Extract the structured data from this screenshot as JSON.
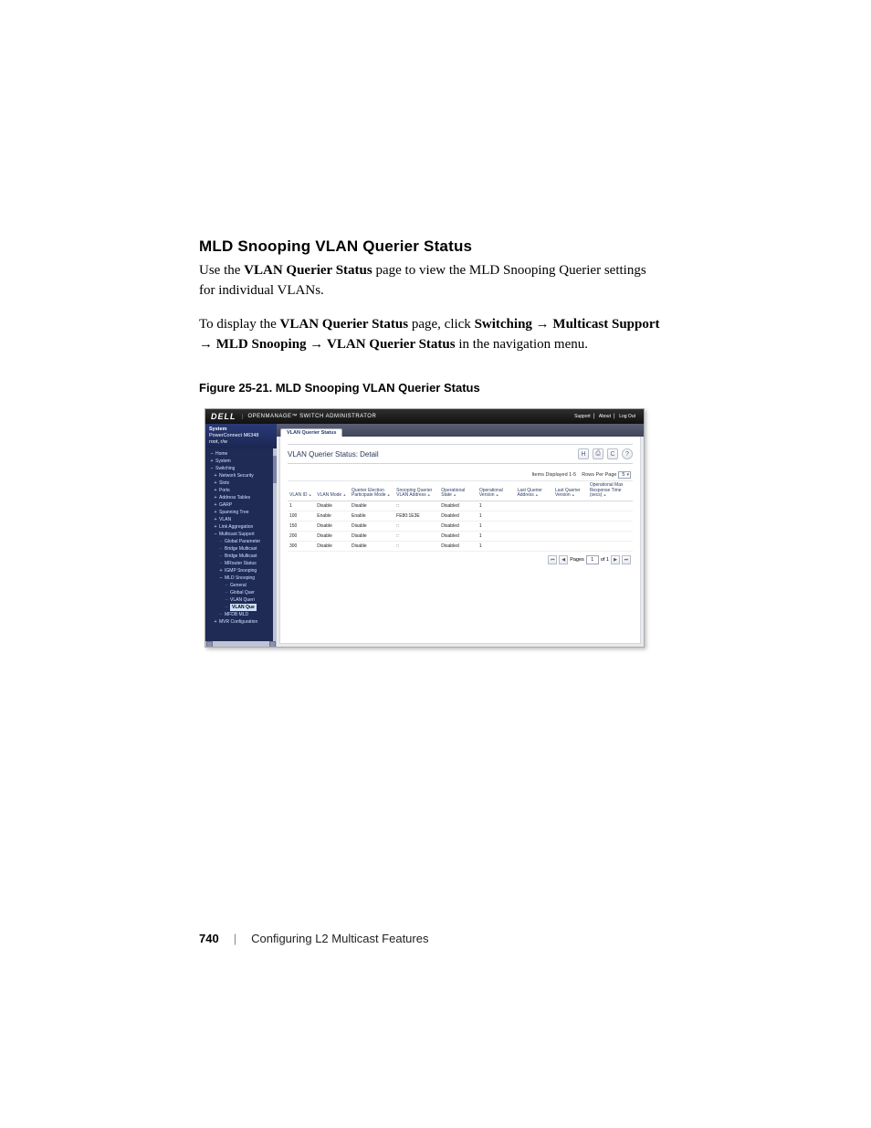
{
  "doc": {
    "section_title": "MLD Snooping VLAN Querier Status",
    "p1_a": "Use the ",
    "p1_b": "VLAN Querier Status",
    "p1_c": " page to view the MLD Snooping Querier settings for individual VLANs.",
    "p2_a": "To display the ",
    "p2_b": "VLAN Querier Status",
    "p2_c": " page, click ",
    "p2_d": "Switching",
    "p2_e": "Multicast Support",
    "p2_f": "MLD Snooping",
    "p2_g": "VLAN Querier Status",
    "p2_h": " in the navigation menu.",
    "arrow": "→",
    "fig_caption": "Figure 25-21.    MLD Snooping VLAN Querier Status",
    "footer_page": "740",
    "footer_section": "Configuring L2 Multicast Features"
  },
  "shot": {
    "brand_logo": "DELL",
    "brand_sub": "OPENMANAGE™ SWITCH ADMINISTRATOR",
    "top_links": {
      "support": "Support",
      "about": "About",
      "logout": "Log Out"
    },
    "sidebar": {
      "system": "System",
      "model": "PowerConnect M6348",
      "addr": "root, r/w",
      "tree": [
        {
          "g": "minus",
          "indent": 0,
          "label": "Home"
        },
        {
          "g": "plus",
          "indent": 0,
          "label": "System"
        },
        {
          "g": "minus",
          "indent": 0,
          "label": "Switching"
        },
        {
          "g": "plus",
          "indent": 1,
          "label": "Network Security"
        },
        {
          "g": "plus",
          "indent": 1,
          "label": "Slots"
        },
        {
          "g": "plus",
          "indent": 1,
          "label": "Ports"
        },
        {
          "g": "plus",
          "indent": 1,
          "label": "Address Tables"
        },
        {
          "g": "plus",
          "indent": 1,
          "label": "GARP"
        },
        {
          "g": "plus",
          "indent": 1,
          "label": "Spanning Tree"
        },
        {
          "g": "plus",
          "indent": 1,
          "label": "VLAN"
        },
        {
          "g": "plus",
          "indent": 1,
          "label": "Link Aggregation"
        },
        {
          "g": "minus",
          "indent": 1,
          "label": "Multicast Support"
        },
        {
          "g": "dash",
          "indent": 2,
          "label": "Global Parameter"
        },
        {
          "g": "dash",
          "indent": 2,
          "label": "Bridge Multicast"
        },
        {
          "g": "dash",
          "indent": 2,
          "label": "Bridge Multicast"
        },
        {
          "g": "dash",
          "indent": 2,
          "label": "MRouter Status"
        },
        {
          "g": "plus",
          "indent": 2,
          "label": "IGMP Snooping"
        },
        {
          "g": "minus",
          "indent": 2,
          "label": "MLD Snooping"
        },
        {
          "g": "dash",
          "indent": 3,
          "label": "General"
        },
        {
          "g": "dash",
          "indent": 3,
          "label": "Global Quer"
        },
        {
          "g": "dash",
          "indent": 3,
          "label": "VLAN Queri"
        },
        {
          "g": "dash",
          "indent": 3,
          "label": "VLAN Que",
          "highlight": true
        },
        {
          "g": "dash",
          "indent": 2,
          "label": "MFDB MLD"
        },
        {
          "g": "plus",
          "indent": 1,
          "label": "MVR Configuration"
        }
      ]
    },
    "tab": "VLAN Querier Status",
    "panel_title": "VLAN Querier Status: Detail",
    "tools": {
      "save": "H",
      "print": "⎙",
      "refresh": "C",
      "help": "?"
    },
    "items_displayed_label": "Items Displayed",
    "items_displayed_value": "1-5",
    "rows_per_page_label": "Rows Per Page",
    "rows_per_page_value": "5",
    "columns": [
      "VLAN ID",
      "VLAN Mode",
      "Querier Election Participate Mode",
      "Snooping Querier VLAN Address",
      "Operational State",
      "Operational Version",
      "Last Querier Address",
      "Last Querier Version",
      "Operational Max Response Time (secs)"
    ],
    "rows": [
      {
        "c0": "1",
        "c1": "Disable",
        "c2": "Disable",
        "c3": "::",
        "c4": "Disabled",
        "c5": "1",
        "c6": "",
        "c7": "",
        "c8": ""
      },
      {
        "c0": "100",
        "c1": "Enable",
        "c2": "Enable",
        "c3": "FE80:1E3E",
        "c4": "Disabled",
        "c5": "1",
        "c6": "",
        "c7": "",
        "c8": ""
      },
      {
        "c0": "150",
        "c1": "Disable",
        "c2": "Disable",
        "c3": "::",
        "c4": "Disabled",
        "c5": "1",
        "c6": "",
        "c7": "",
        "c8": ""
      },
      {
        "c0": "200",
        "c1": "Disable",
        "c2": "Disable",
        "c3": "::",
        "c4": "Disabled",
        "c5": "1",
        "c6": "",
        "c7": "",
        "c8": ""
      },
      {
        "c0": "300",
        "c1": "Disable",
        "c2": "Disable",
        "c3": "::",
        "c4": "Disabled",
        "c5": "1",
        "c6": "",
        "c7": "",
        "c8": ""
      }
    ],
    "pager": {
      "first": "⏮",
      "prev": "◀",
      "pages_label": "Pages",
      "page": "1",
      "of_label": "of 1",
      "next": "▶",
      "last": "⏭"
    }
  }
}
